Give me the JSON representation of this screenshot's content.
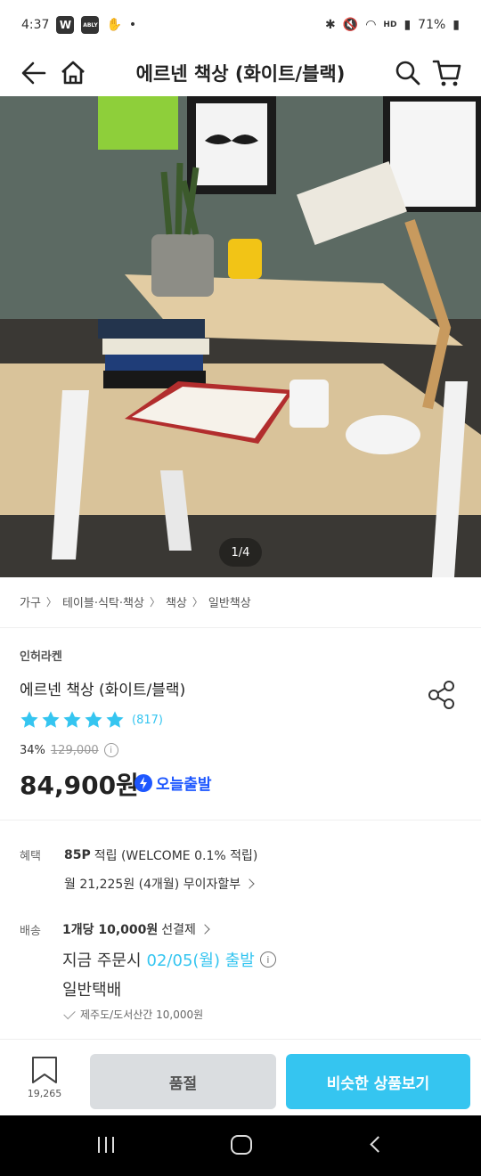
{
  "status_bar": {
    "time": "4:37",
    "app_badges": [
      "W",
      "ABLY"
    ],
    "battery": "71%",
    "network": "HD"
  },
  "appbar": {
    "title": "에르넨 책상 (화이트/블랙)",
    "back_icon": "arrow-left-icon",
    "home_icon": "home-icon",
    "search_icon": "search-icon",
    "cart_icon": "cart-icon"
  },
  "hero": {
    "pager": "1/4"
  },
  "breadcrumb": [
    "가구",
    "테이블·식탁·책상",
    "책상",
    "일반책상"
  ],
  "product": {
    "brand": "인허라켄",
    "name": "에르넨 책상 (화이트/블랙)",
    "rating_stars": 5,
    "review_count": "(817)",
    "discount_pct": "34%",
    "original_price": "129,000",
    "price": "84,900원",
    "today_label": "오늘출발"
  },
  "benefit": {
    "label": "혜택",
    "points": "85P",
    "points_suffix": "적립 (WELCOME 0.1% 적립)",
    "installment": "월 21,225원 (4개월) 무이자할부"
  },
  "shipping": {
    "label": "배송",
    "fee_bold": "1개당 10,000원",
    "fee_suffix": "선결제",
    "order_prefix": "지금 주문시",
    "order_date": "02/05(월) 출발",
    "method": "일반택배",
    "island_note": "제주도/도서산간 10,000원"
  },
  "actions": {
    "bookmark_count": "19,265",
    "soldout_label": "품절",
    "similar_label": "비슷한 상품보기"
  },
  "colors": {
    "accent": "#35c5f0",
    "today_blue": "#1e57ff",
    "soldout_bg": "#dadde0"
  }
}
